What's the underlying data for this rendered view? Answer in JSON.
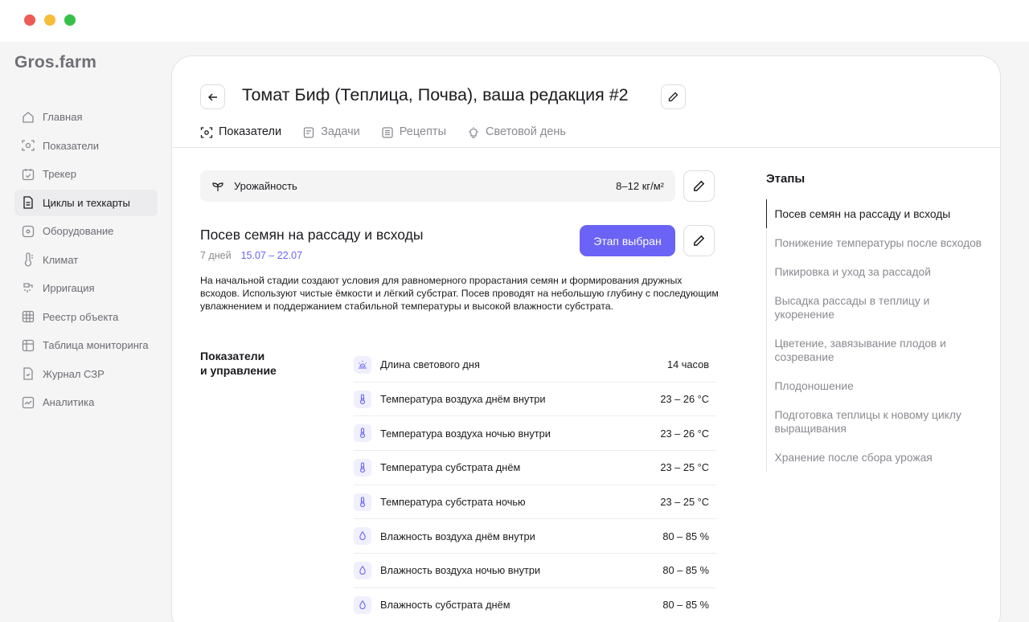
{
  "window": {
    "controls": [
      "close",
      "minimize",
      "maximize"
    ]
  },
  "brand": {
    "logo_text": "Gros.farm"
  },
  "sidebar": {
    "items": [
      {
        "label": "Главная",
        "icon": "home-icon",
        "active": false
      },
      {
        "label": "Показатели",
        "icon": "indicators-icon",
        "active": false
      },
      {
        "label": "Трекер",
        "icon": "calendar-icon",
        "active": false
      },
      {
        "label": "Циклы и техкарты",
        "icon": "document-icon",
        "active": true
      },
      {
        "label": "Оборудование",
        "icon": "equipment-icon",
        "active": false
      },
      {
        "label": "Климат",
        "icon": "thermometer-icon",
        "active": false
      },
      {
        "label": "Ирригация",
        "icon": "irrigation-icon",
        "active": false
      },
      {
        "label": "Реестр объекта",
        "icon": "grid-icon",
        "active": false
      },
      {
        "label": "Таблица мониторинга",
        "icon": "table-icon",
        "active": false
      },
      {
        "label": "Журнал СЗР",
        "icon": "journal-icon",
        "active": false
      },
      {
        "label": "Аналитика",
        "icon": "chart-icon",
        "active": false
      }
    ]
  },
  "header": {
    "title": "Томат Биф (Теплица, Почва), ваша редакция #2",
    "tabs": [
      {
        "label": "Показатели",
        "icon": "indicators-icon",
        "active": true
      },
      {
        "label": "Задачи",
        "icon": "tasks-icon",
        "active": false
      },
      {
        "label": "Рецепты",
        "icon": "recipes-icon",
        "active": false
      },
      {
        "label": "Световой день",
        "icon": "bulb-icon",
        "active": false
      }
    ]
  },
  "yield": {
    "label": "Урожайность",
    "value": "8–12 кг/м²"
  },
  "stage": {
    "title": "Посев семян на рассаду и всходы",
    "duration": "7 дней",
    "dates": "15.07 – 22.07",
    "button_label": "Этап выбран",
    "description": "На начальной стадии создают условия для равномерного прорастания семян и формирования дружных всходов. Используют чистые ёмкости и лёгкий субстрат. Посев проводят на небольшую глубину с последующим увлажнением и поддержанием стабильной температуры и высокой влажности субстрата."
  },
  "metrics": {
    "heading_line1": "Показатели",
    "heading_line2": "и управление",
    "rows": [
      {
        "label": "Длина светового дня",
        "value": "14 часов",
        "icon": "sun-icon"
      },
      {
        "label": "Температура воздуха днём внутри",
        "value": "23 – 26 °C",
        "icon": "thermometer-icon"
      },
      {
        "label": "Температура воздуха ночью внутри",
        "value": "23 – 26 °C",
        "icon": "thermometer-icon"
      },
      {
        "label": "Температура субстрата днём",
        "value": "23 – 25 °C",
        "icon": "thermometer-icon"
      },
      {
        "label": "Температура субстрата ночью",
        "value": "23 – 25 °C",
        "icon": "thermometer-icon"
      },
      {
        "label": "Влажность воздуха днём внутри",
        "value": "80 – 85 %",
        "icon": "droplet-icon"
      },
      {
        "label": "Влажность воздуха ночью внутри",
        "value": "80 – 85 %",
        "icon": "droplet-icon"
      },
      {
        "label": "Влажность субстрата днём",
        "value": "80 – 85 %",
        "icon": "droplet-icon"
      }
    ]
  },
  "stages": {
    "heading": "Этапы",
    "items": [
      {
        "label": "Посев семян на рассаду и всходы",
        "active": true
      },
      {
        "label": "Понижение температуры после всходов",
        "active": false
      },
      {
        "label": "Пикировка и уход за рассадой",
        "active": false
      },
      {
        "label": "Высадка рассады в теплицу и укоренение",
        "active": false
      },
      {
        "label": "Цветение, завязывание плодов и созревание",
        "active": false
      },
      {
        "label": "Плодоношение",
        "active": false
      },
      {
        "label": "Подготовка теплицы к новому циклу выращивания",
        "active": false
      },
      {
        "label": "Хранение после сбора урожая",
        "active": false
      }
    ]
  },
  "colors": {
    "accent": "#6a63f5",
    "text": "#1b1b1f",
    "muted": "#8a8a91",
    "metric_icon_bg": "#f0effd"
  }
}
